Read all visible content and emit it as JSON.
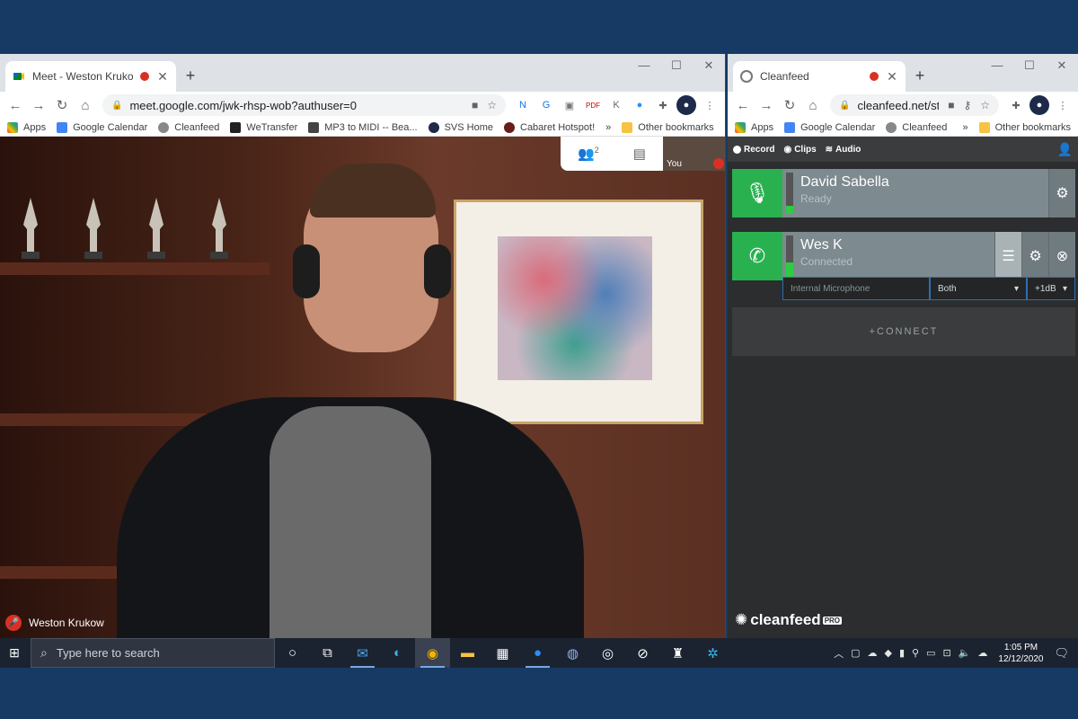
{
  "left_browser": {
    "tab_title": "Meet - Weston Krukow - Voi",
    "url": "meet.google.com/jwk-rhsp-wob?authuser=0",
    "bookmarks": [
      "Apps",
      "Google Calendar",
      "Cleanfeed",
      "WeTransfer",
      "MP3 to MIDI -- Bea...",
      "SVS Home",
      "Cabaret Hotspot!"
    ],
    "bookmarks_more": "»",
    "other_bookmarks": "Other bookmarks"
  },
  "meet": {
    "participant_count": "2",
    "self_label": "You",
    "speaker_name": "Weston Krukow"
  },
  "right_browser": {
    "tab_title": "Cleanfeed",
    "url": "cleanfeed.net/st...",
    "bookmarks": [
      "Apps",
      "Google Calendar",
      "Cleanfeed"
    ],
    "bookmarks_more": "»",
    "other_bookmarks": "Other bookmarks"
  },
  "cleanfeed": {
    "toolbar": {
      "record": "Record",
      "clips": "Clips",
      "audio": "Audio"
    },
    "participants": [
      {
        "name": "David Sabella",
        "status": "Ready",
        "level": 0.2
      },
      {
        "name": "Wes K",
        "status": "Connected",
        "level": 0.35
      }
    ],
    "input_placeholder": "Internal Microphone",
    "channel": "Both",
    "gain": "+1dB",
    "connect_label": "+CONNECT",
    "logo_text": "cleanfeed",
    "logo_badge": "PRO"
  },
  "taskbar": {
    "search_placeholder": "Type here to search",
    "time": "1:05 PM",
    "date": "12/12/2020"
  },
  "colors": {
    "desktop": "#163a63",
    "cleanfeed_green": "#29b150",
    "record_red": "#d93025"
  }
}
